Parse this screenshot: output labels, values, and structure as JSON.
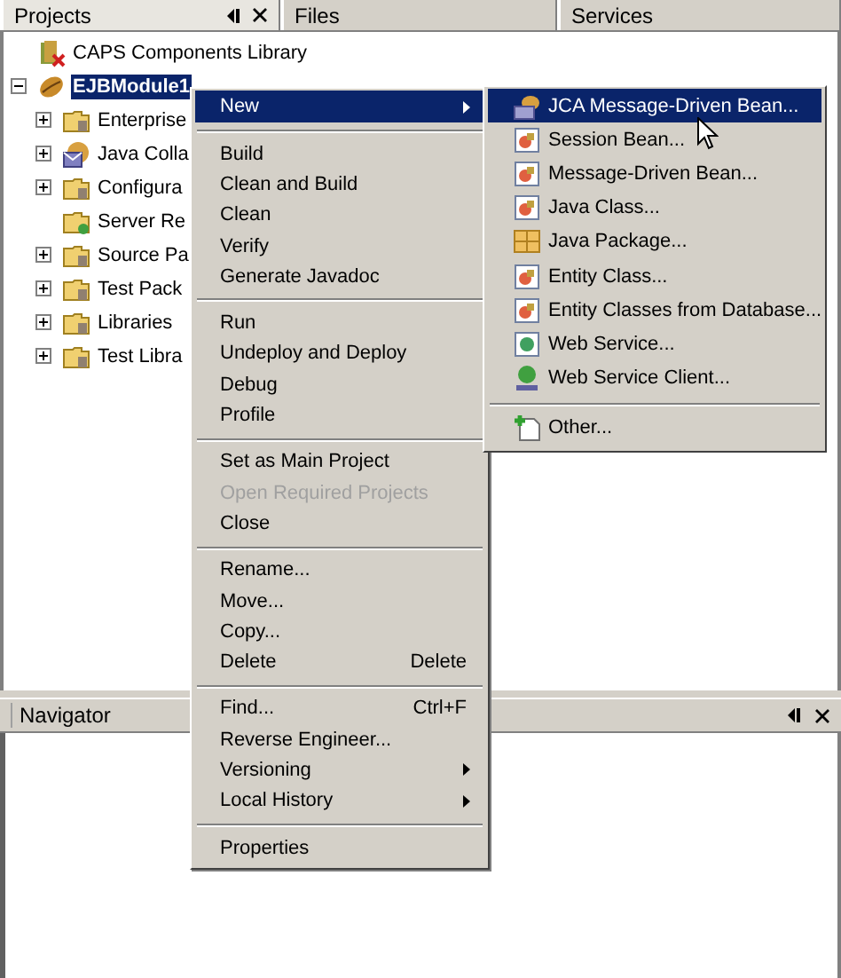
{
  "tabs": [
    {
      "label": "Projects",
      "selected": true
    },
    {
      "label": "Files",
      "selected": false
    },
    {
      "label": "Services",
      "selected": false
    }
  ],
  "projects_tree": [
    {
      "label": "CAPS Components Library",
      "kind": "library",
      "selected": false
    },
    {
      "label": "EJBModule1",
      "kind": "module",
      "selected": true,
      "expanded": true,
      "children": [
        {
          "label": "Enterprise",
          "kind": "folder"
        },
        {
          "label": "Java Colla",
          "kind": "collab"
        },
        {
          "label": "Configura",
          "kind": "folder"
        },
        {
          "label": "Server Re",
          "kind": "leaf"
        },
        {
          "label": "Source Pa",
          "kind": "folder"
        },
        {
          "label": "Test Pack",
          "kind": "folder"
        },
        {
          "label": "Libraries",
          "kind": "folder"
        },
        {
          "label": "Test Libra",
          "kind": "folder"
        }
      ]
    }
  ],
  "context_menu": [
    {
      "kind": "submenu",
      "label": "New",
      "selected": true,
      "disabled": false
    },
    {
      "kind": "separator"
    },
    {
      "kind": "item",
      "label": "Build",
      "selected": false,
      "disabled": false
    },
    {
      "kind": "item",
      "label": "Clean and Build",
      "selected": false,
      "disabled": false
    },
    {
      "kind": "item",
      "label": "Clean",
      "selected": false,
      "disabled": false
    },
    {
      "kind": "item",
      "label": "Verify",
      "selected": false,
      "disabled": false
    },
    {
      "kind": "item",
      "label": "Generate Javadoc",
      "selected": false,
      "disabled": false
    },
    {
      "kind": "separator"
    },
    {
      "kind": "item",
      "label": "Run",
      "selected": false,
      "disabled": false
    },
    {
      "kind": "item",
      "label": "Undeploy and Deploy",
      "selected": false,
      "disabled": false
    },
    {
      "kind": "item",
      "label": "Debug",
      "selected": false,
      "disabled": false
    },
    {
      "kind": "item",
      "label": "Profile",
      "selected": false,
      "disabled": false
    },
    {
      "kind": "separator"
    },
    {
      "kind": "item",
      "label": "Set as Main Project",
      "selected": false,
      "disabled": false
    },
    {
      "kind": "item",
      "label": "Open Required Projects",
      "selected": false,
      "disabled": true
    },
    {
      "kind": "item",
      "label": "Close",
      "selected": false,
      "disabled": false
    },
    {
      "kind": "separator"
    },
    {
      "kind": "item",
      "label": "Rename...",
      "selected": false,
      "disabled": false
    },
    {
      "kind": "item",
      "label": "Move...",
      "selected": false,
      "disabled": false
    },
    {
      "kind": "item",
      "label": "Copy...",
      "selected": false,
      "disabled": false
    },
    {
      "kind": "item",
      "label": "Delete",
      "shortcut": "Delete",
      "selected": false,
      "disabled": false
    },
    {
      "kind": "separator"
    },
    {
      "kind": "item",
      "label": "Find...",
      "shortcut": "Ctrl+F",
      "selected": false,
      "disabled": false
    },
    {
      "kind": "item",
      "label": "Reverse Engineer...",
      "selected": false,
      "disabled": false
    },
    {
      "kind": "submenu",
      "label": "Versioning",
      "selected": false,
      "disabled": false
    },
    {
      "kind": "submenu",
      "label": "Local History",
      "selected": false,
      "disabled": false
    },
    {
      "kind": "separator"
    },
    {
      "kind": "item",
      "label": "Properties",
      "selected": false,
      "disabled": false
    }
  ],
  "new_submenu": [
    {
      "kind": "bean",
      "label": "JCA Message-Driven Bean...",
      "selected": true
    },
    {
      "kind": "class",
      "label": "Session Bean...",
      "selected": false
    },
    {
      "kind": "class",
      "label": "Message-Driven Bean...",
      "selected": false
    },
    {
      "kind": "class",
      "label": "Java Class...",
      "selected": false
    },
    {
      "kind": "package",
      "label": "Java Package...",
      "selected": false
    },
    {
      "kind": "class",
      "label": "Entity Class...",
      "selected": false
    },
    {
      "kind": "class",
      "label": "Entity Classes from Database...",
      "selected": false
    },
    {
      "kind": "web-service",
      "label": "Web Service...",
      "selected": false
    },
    {
      "kind": "web-client",
      "label": "Web Service Client...",
      "selected": false
    },
    {
      "kind": "separator"
    },
    {
      "kind": "other",
      "label": "Other...",
      "selected": false
    }
  ],
  "navigator": {
    "title": "Navigator"
  }
}
